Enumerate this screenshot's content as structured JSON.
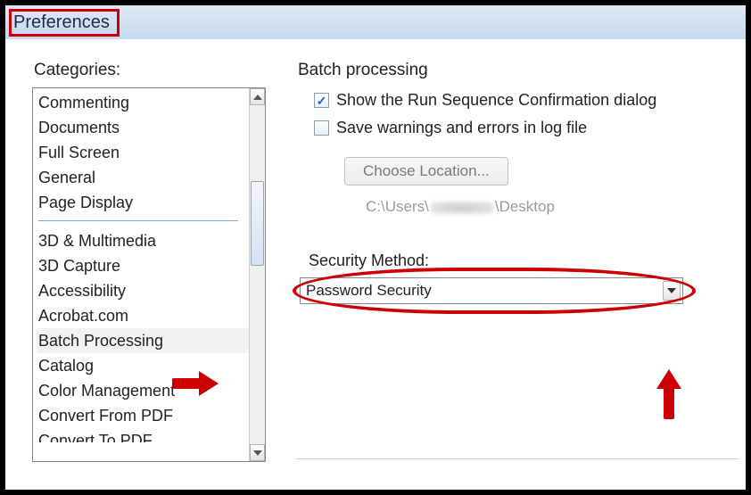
{
  "window": {
    "title": "Preferences"
  },
  "left": {
    "heading": "Categories:",
    "top_items": [
      "Commenting",
      "Documents",
      "Full Screen",
      "General",
      "Page Display"
    ],
    "bottom_items": [
      "3D & Multimedia",
      "3D Capture",
      "Accessibility",
      "Acrobat.com",
      "Batch Processing",
      "Catalog",
      "Color Management",
      "Convert From PDF",
      "Convert To PDF"
    ],
    "selected": "Batch Processing"
  },
  "right": {
    "section_title": "Batch processing",
    "cb_show_confirm": {
      "label": "Show the Run Sequence Confirmation dialog",
      "checked": true
    },
    "cb_save_log": {
      "label": "Save warnings and errors in log file",
      "checked": false
    },
    "choose_location_btn": "Choose Location...",
    "path_prefix": "C:\\Users\\",
    "path_suffix": "\\Desktop",
    "security_method_label": "Security Method:",
    "security_method_value": "Password Security"
  }
}
